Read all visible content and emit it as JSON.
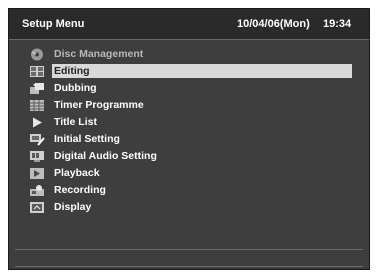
{
  "header": {
    "title": "Setup Menu",
    "date": "10/04/06(Mon)",
    "time": "19:34"
  },
  "menu": {
    "items": [
      {
        "label": "Disc Management",
        "icon": "disc-icon",
        "state": "disabled"
      },
      {
        "label": "Editing",
        "icon": "editing-icon",
        "state": "selected"
      },
      {
        "label": "Dubbing",
        "icon": "dubbing-icon",
        "state": "normal"
      },
      {
        "label": "Timer Programme",
        "icon": "timer-icon",
        "state": "normal"
      },
      {
        "label": "Title List",
        "icon": "play-icon",
        "state": "normal"
      },
      {
        "label": "Initial Setting",
        "icon": "initial-setting-icon",
        "state": "normal"
      },
      {
        "label": "Digital Audio Setting",
        "icon": "digital-audio-icon",
        "state": "normal"
      },
      {
        "label": "Playback",
        "icon": "playback-icon",
        "state": "normal"
      },
      {
        "label": "Recording",
        "icon": "recording-icon",
        "state": "normal"
      },
      {
        "label": "Display",
        "icon": "display-icon",
        "state": "normal"
      }
    ]
  },
  "colors": {
    "panel": "#3e3e3e",
    "highlight": "#d9d9d9",
    "disabled_text": "#b9b9b9"
  }
}
